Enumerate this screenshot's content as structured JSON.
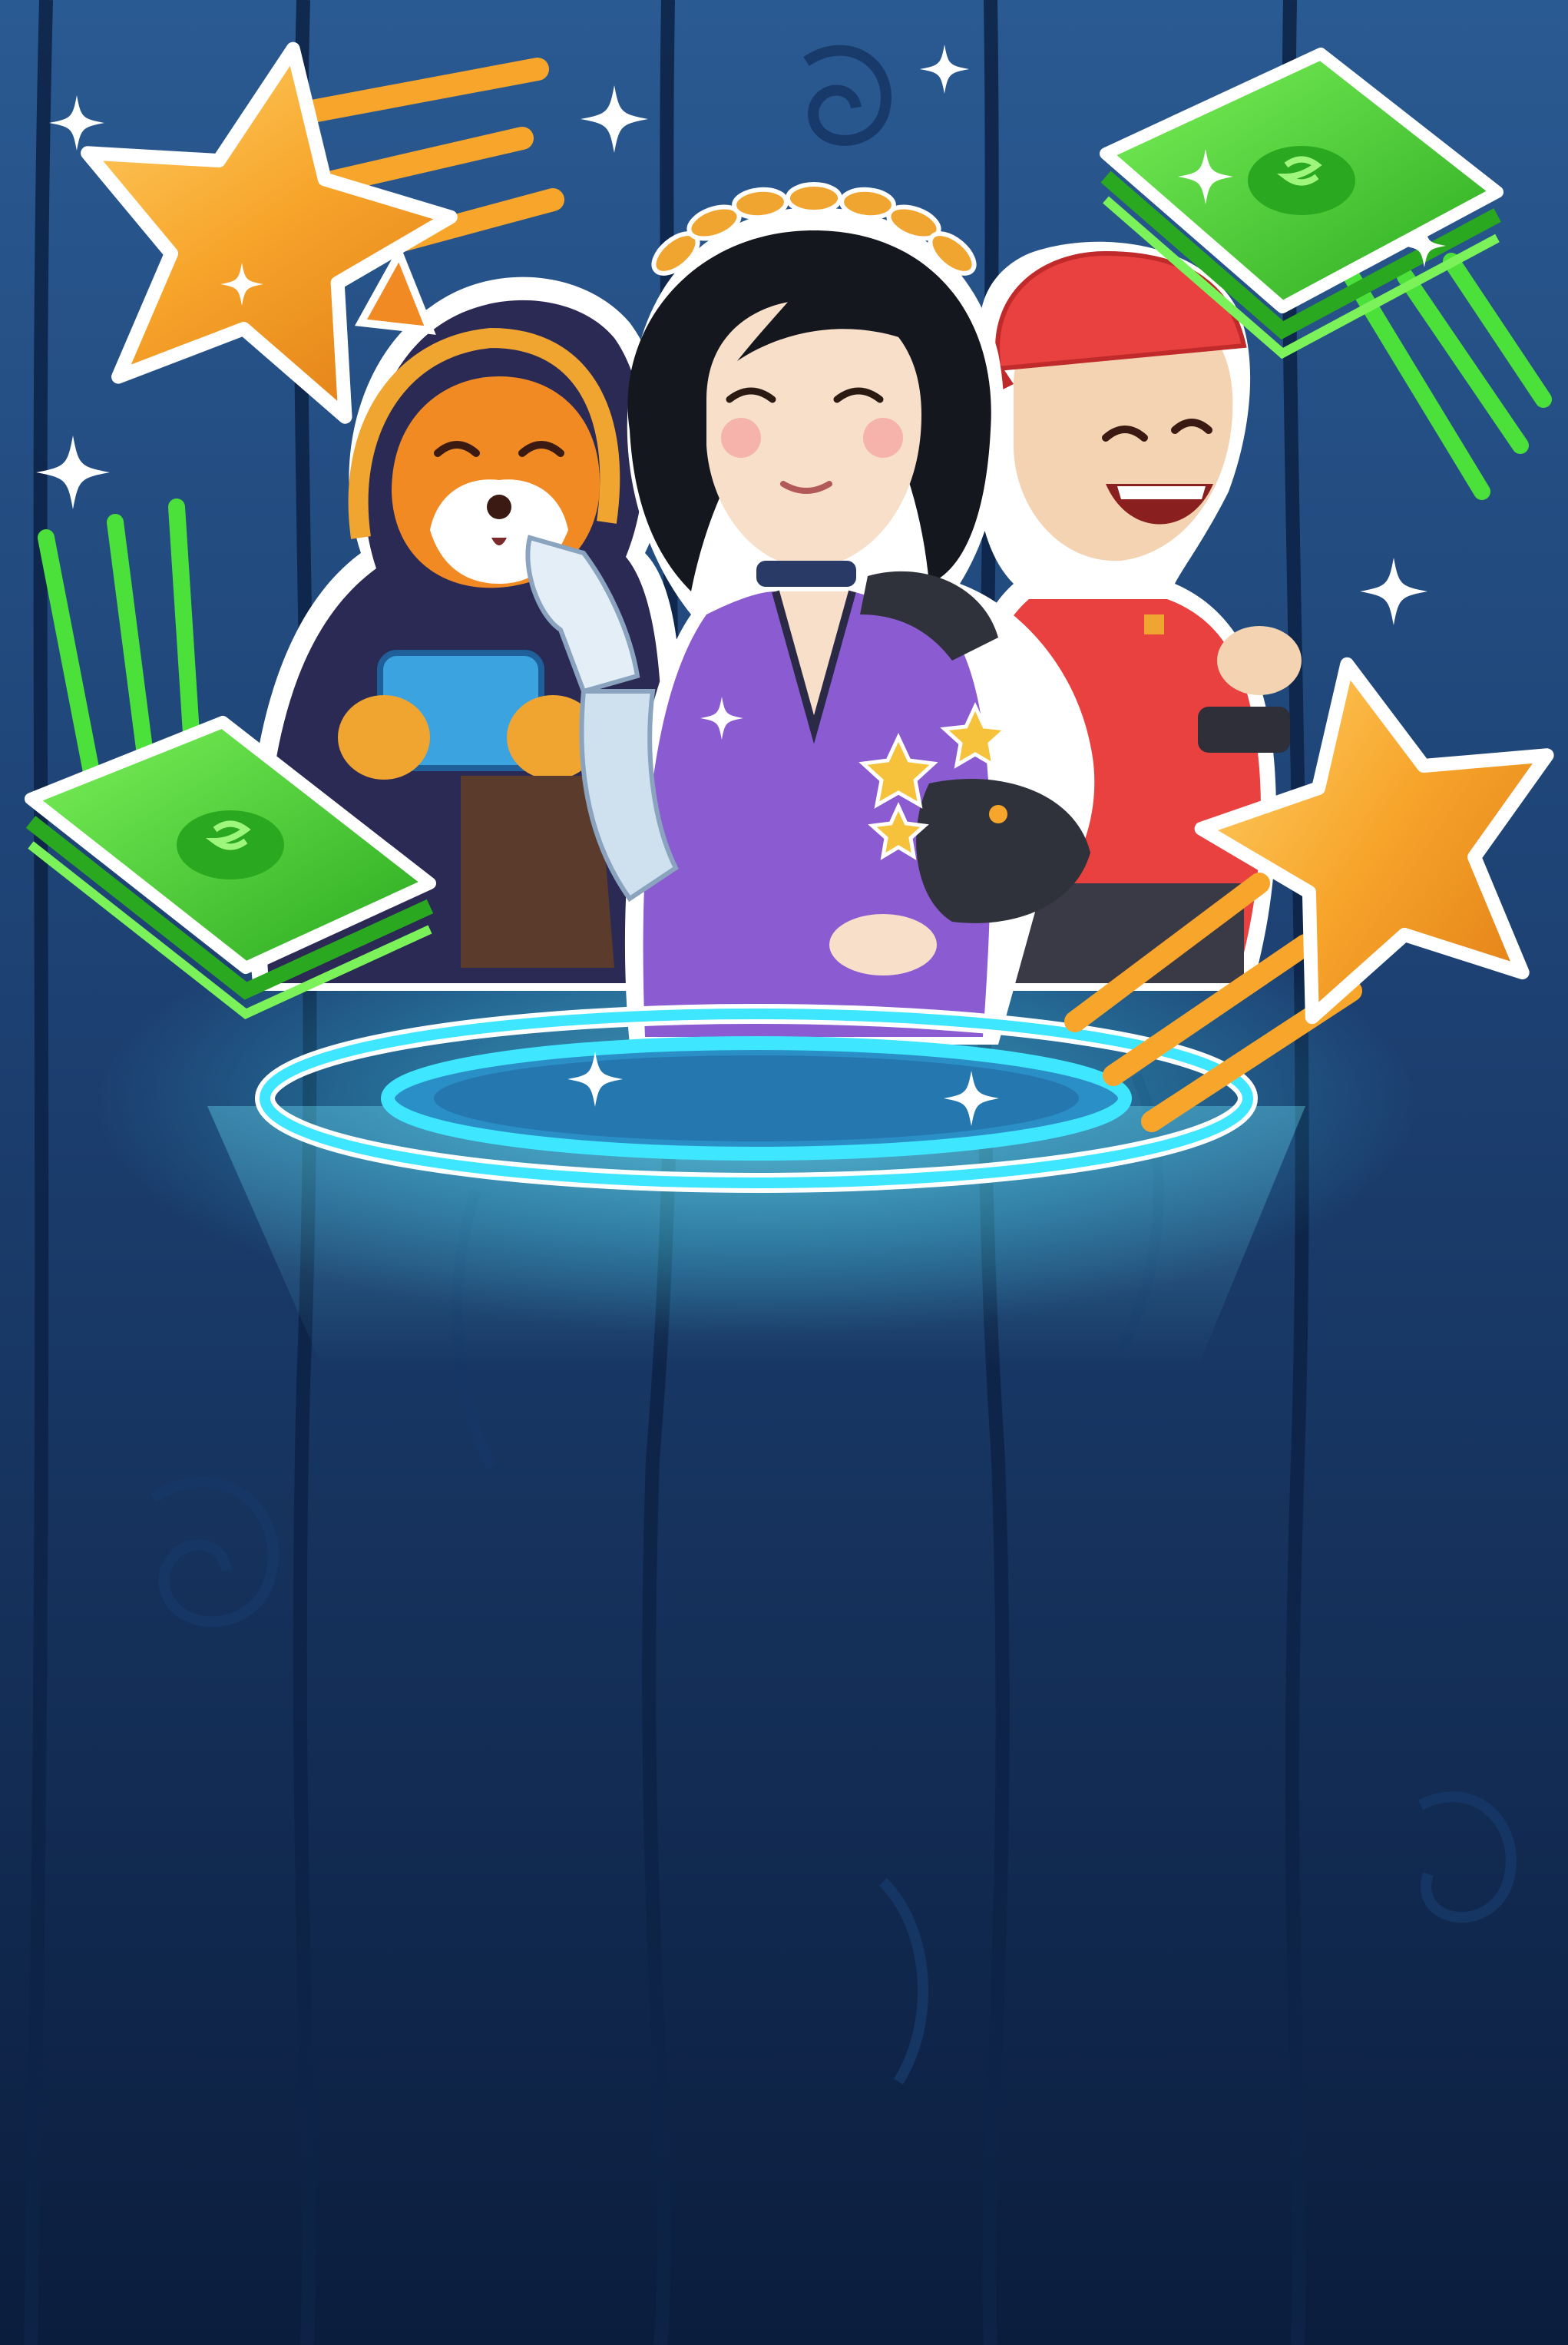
{
  "scene": {
    "kind": "illustration",
    "characters": [
      "hooded-fox-gamer",
      "laurel-crowned-woman",
      "red-cap-man"
    ],
    "items": [
      "gold-star",
      "cash-stack",
      "sparkle",
      "glowing-portal"
    ],
    "colors": {
      "background_top": "#2a5a92",
      "background_bottom": "#0b1d3d",
      "panel_stroke": "#0d2447",
      "portal_glow": "#3fe6ff",
      "star_gold": "#f7a52b",
      "cash_green": "#3fc92e",
      "woman_shirt": "#8a5bd1",
      "man_shirt": "#e9413f",
      "fox_robe": "#2a2a55"
    },
    "text": []
  }
}
